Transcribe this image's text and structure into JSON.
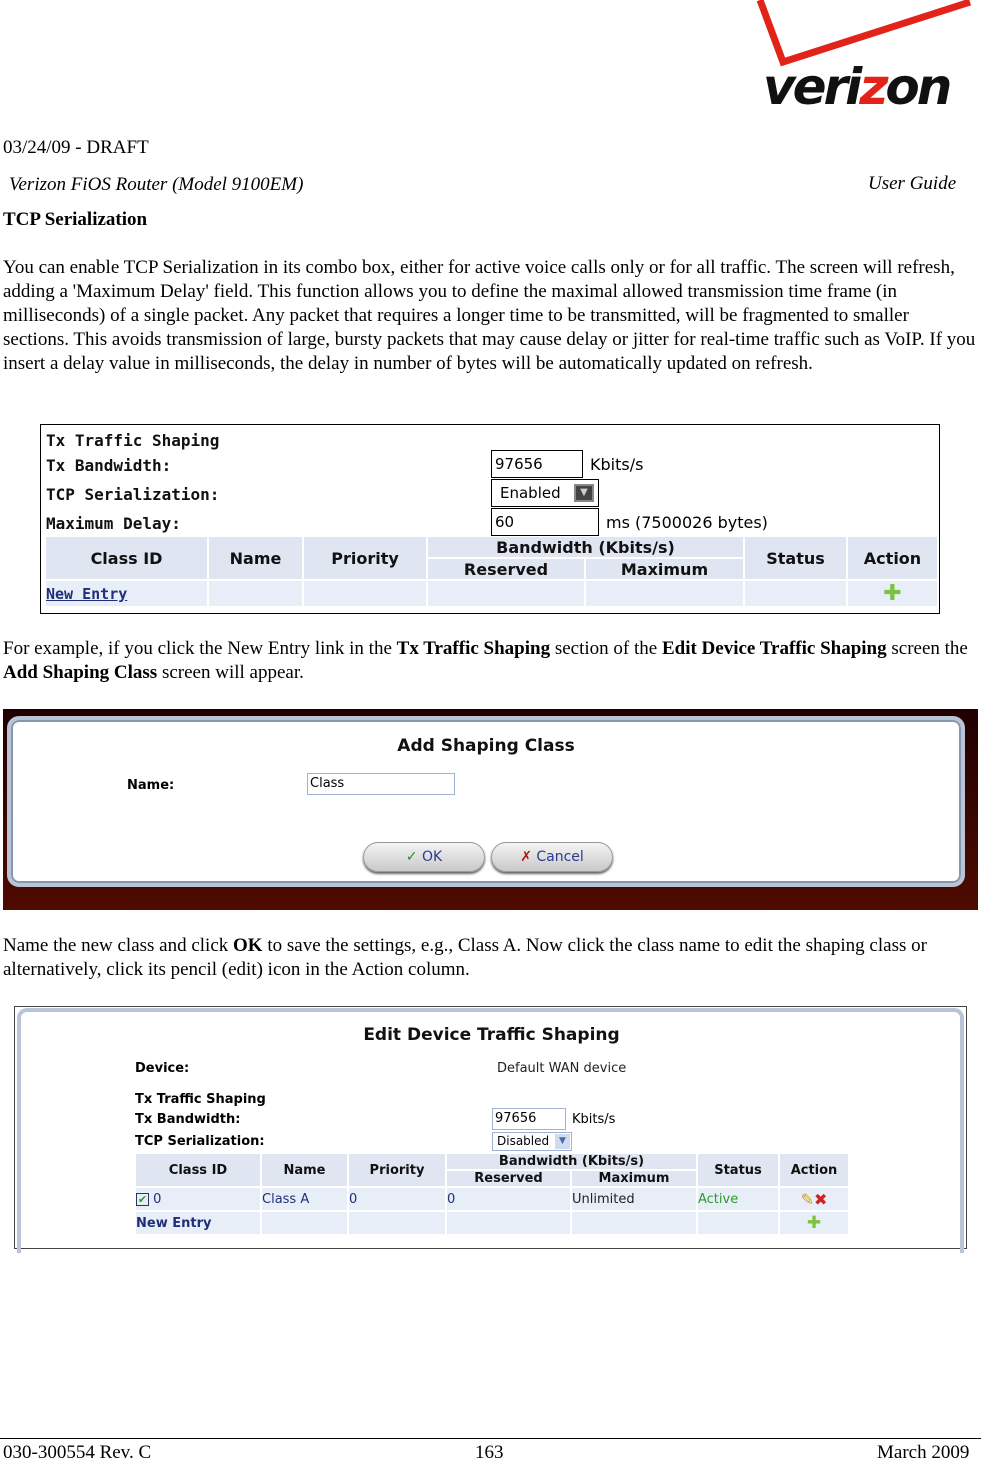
{
  "header": {
    "draft": "03/24/09 - DRAFT",
    "product": "Verizon FiOS Router (Model 9100EM)",
    "guide": "User Guide",
    "logo_text": "verizon"
  },
  "section_title": "TCP Serialization",
  "para1": "You can enable TCP Serialization in its combo box, either for active voice calls only or for all traffic. The screen will refresh, adding a 'Maximum Delay' field.  This function allows you to define the maximal allowed transmission time frame (in milliseconds) of a single packet. Any packet that requires a longer time to be transmitted, will be fragmented to smaller sections. This avoids transmission of large, bursty packets that may cause delay or jitter for real-time traffic such as VoIP. If you insert a delay value in milliseconds, the delay in number of bytes will be automatically updated on refresh.",
  "shot1": {
    "title": "Tx Traffic Shaping",
    "bw_label": "Tx Bandwidth:",
    "bw_value": "97656",
    "bw_unit": "Kbits/s",
    "tcp_label": "TCP Serialization:",
    "tcp_value": "Enabled",
    "delay_label": "Maximum Delay:",
    "delay_value": "60",
    "delay_unit": "ms (7500026 bytes)",
    "cols": {
      "class_id": "Class ID",
      "name": "Name",
      "priority": "Priority",
      "bandwidth": "Bandwidth (Kbits/s)",
      "reserved": "Reserved",
      "maximum": "Maximum",
      "status": "Status",
      "action": "Action"
    },
    "new_entry": "New Entry",
    "icons": {
      "add": "add-icon"
    }
  },
  "para2": {
    "a": "For example, if you click the New Entry link in the ",
    "b": "Tx Traffic Shaping",
    "c": " section of the ",
    "d": "Edit Device Traffic Shaping",
    "e": " screen  the ",
    "f": "Add Shaping Class",
    "g": " screen will appear."
  },
  "shot2": {
    "title": "Add Shaping Class",
    "name_label": "Name:",
    "name_value": "Class",
    "ok": "OK",
    "cancel": "Cancel"
  },
  "para3": {
    "a": "Name the new class and click ",
    "b": "OK",
    "c": " to save the settings, e.g., Class A. Now click the class name to edit the shaping class or alternatively, click its pencil (edit) icon in the Action column."
  },
  "shot3": {
    "title": "Edit Device Traffic Shaping",
    "device_label": "Device:",
    "device_value": "Default WAN device",
    "section": "Tx Traffic Shaping",
    "bw_label": "Tx Bandwidth:",
    "bw_value": "97656",
    "bw_unit": "Kbits/s",
    "tcp_label": "TCP Serialization:",
    "tcp_value": "Disabled",
    "cols": {
      "class_id": "Class ID",
      "name": "Name",
      "priority": "Priority",
      "bandwidth": "Bandwidth (Kbits/s)",
      "reserved": "Reserved",
      "maximum": "Maximum",
      "status": "Status",
      "action": "Action"
    },
    "row": {
      "class_id": "0",
      "checked": true,
      "name": "Class A",
      "priority": "0",
      "reserved": "0",
      "maximum": "Unlimited",
      "status": "Active"
    },
    "new_entry": "New Entry",
    "status_color": "#2e9a2e"
  },
  "footer": {
    "doc": "030-300554 Rev. C",
    "page": "163",
    "date": "March 2009"
  },
  "colors": {
    "brand_red": "#e2231a",
    "link": "#1f2f7a"
  }
}
